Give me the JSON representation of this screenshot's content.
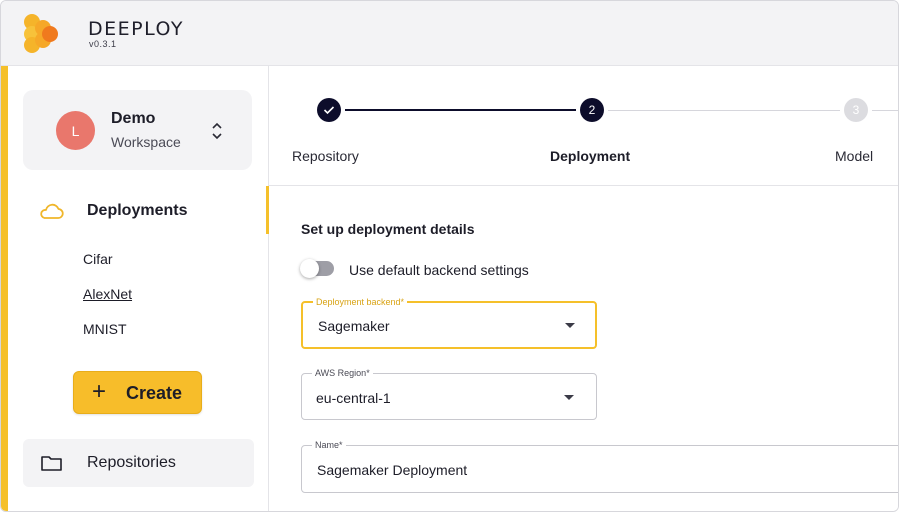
{
  "app": {
    "title": "DEEPLOY",
    "version": "v0.3.1"
  },
  "colors": {
    "accent": "#f5c02a",
    "dark": "#0d0d2b",
    "avatar": "#e9776c",
    "logo_primary": "#f5b42a",
    "logo_secondary": "#f07a1e"
  },
  "sidebar": {
    "workspace": {
      "avatar_initial": "L",
      "name": "Demo",
      "subtitle": "Workspace",
      "chevron_icon": "chevron-up-down-icon"
    },
    "deployments": {
      "icon": "cloud-icon",
      "label": "Deployments",
      "items": [
        {
          "label": "Cifar"
        },
        {
          "label": "AlexNet",
          "active": true
        },
        {
          "label": "MNIST"
        }
      ]
    },
    "create_button": {
      "icon": "plus-icon",
      "label": "Create"
    },
    "repositories": {
      "icon": "folder-icon",
      "label": "Repositories"
    }
  },
  "stepper": {
    "steps": [
      {
        "label": "Repository",
        "state": "completed",
        "marker": "✓"
      },
      {
        "label": "Deployment",
        "state": "active",
        "marker": "2"
      },
      {
        "label": "Model",
        "state": "pending",
        "marker": "3"
      }
    ]
  },
  "form": {
    "section_title": "Set up deployment details",
    "default_backend_toggle": {
      "label": "Use default backend settings",
      "checked": false
    },
    "backend": {
      "label": "Deployment backend*",
      "value": "Sagemaker"
    },
    "region": {
      "label": "AWS Region*",
      "value": "eu-central-1"
    },
    "name": {
      "label": "Name*",
      "value": "Sagemaker Deployment"
    }
  }
}
